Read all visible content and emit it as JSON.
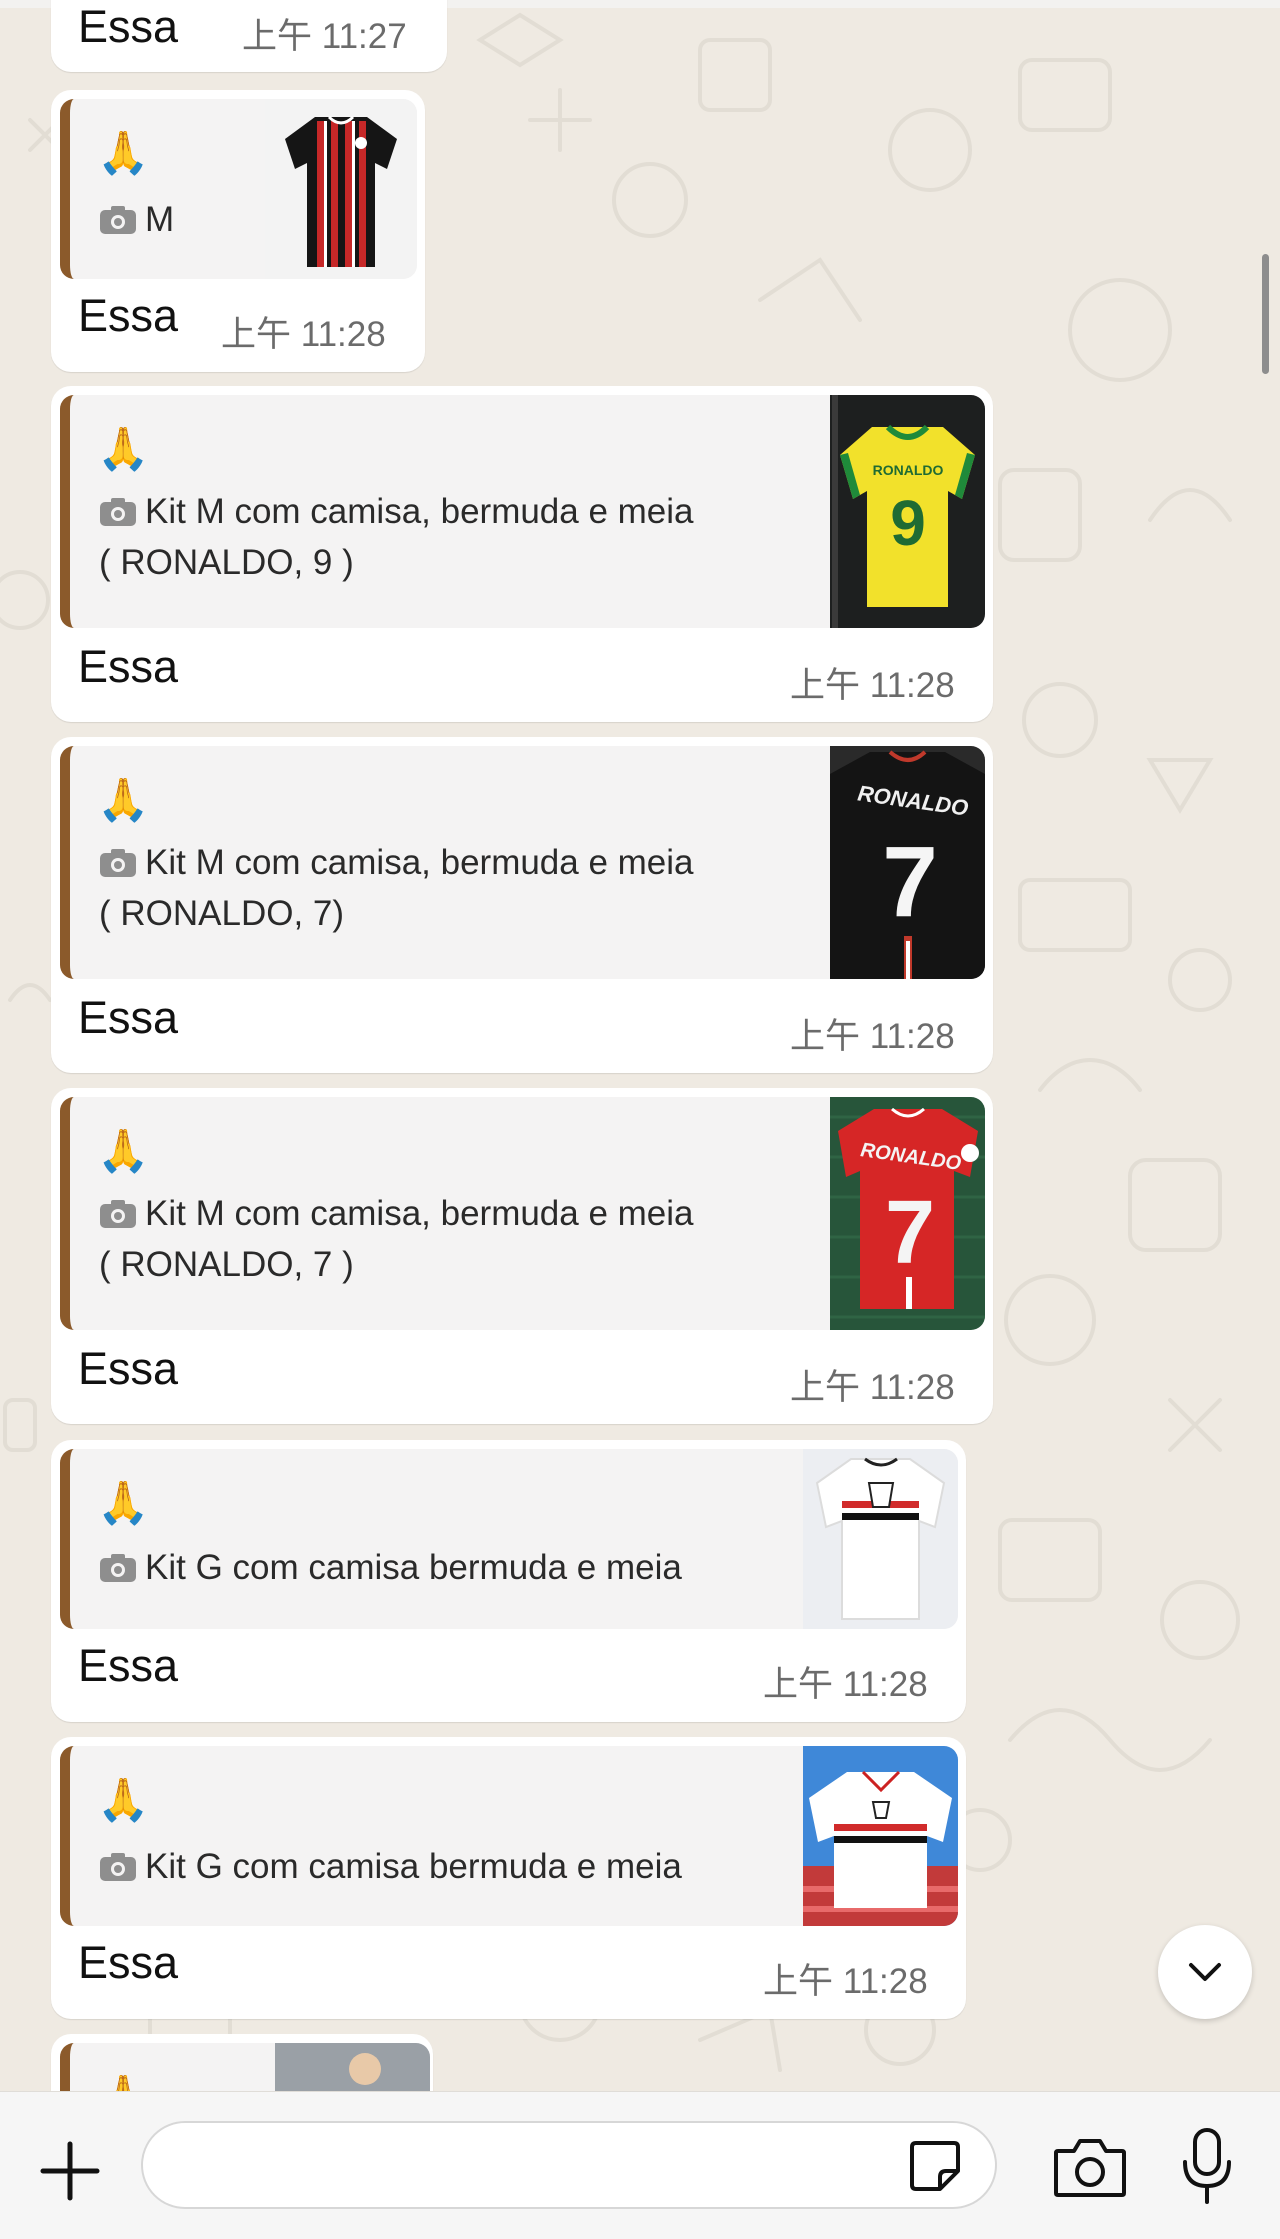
{
  "colors": {
    "wallpaper": "#efeae2",
    "bubble": "#ffffff",
    "quote_bg": "#f4f3f3",
    "quote_bar": "#8b5a2b",
    "timestamp": "#6b6b6b"
  },
  "messages": [
    {
      "quote": {
        "emoji": "🙏",
        "icon": "camera-icon",
        "lines": []
      },
      "text": "Essa",
      "time": "上午 11:27"
    },
    {
      "quote": {
        "emoji": "🙏",
        "icon": "camera-icon",
        "lines": [
          "M"
        ],
        "thumbnail": "jersey-red-black-stripes"
      },
      "text": "Essa",
      "time": "上午 11:28"
    },
    {
      "quote": {
        "emoji": "🙏",
        "icon": "camera-icon",
        "lines": [
          "Kit M com camisa, bermuda e meia",
          "( RONALDO, 9 )"
        ],
        "thumbnail": "jersey-yellow-ronaldo-9"
      },
      "text": "Essa",
      "time": "上午 11:28"
    },
    {
      "quote": {
        "emoji": "🙏",
        "icon": "camera-icon",
        "lines": [
          "Kit M com camisa, bermuda e meia",
          "( RONALDO, 7)"
        ],
        "thumbnail": "jersey-black-ronaldo-7"
      },
      "text": "Essa",
      "time": "上午 11:28"
    },
    {
      "quote": {
        "emoji": "🙏",
        "icon": "camera-icon",
        "lines": [
          "Kit M com camisa, bermuda e meia",
          "( RONALDO, 7 )"
        ],
        "thumbnail": "jersey-red-ronaldo-7"
      },
      "text": "Essa",
      "time": "上午 11:28"
    },
    {
      "quote": {
        "emoji": "🙏",
        "icon": "camera-icon",
        "lines": [
          "Kit G com camisa bermuda e meia"
        ],
        "thumbnail": "jersey-white-tricolor"
      },
      "text": "Essa",
      "time": "上午 11:28"
    },
    {
      "quote": {
        "emoji": "🙏",
        "icon": "camera-icon",
        "lines": [
          "Kit G com camisa bermuda e meia"
        ],
        "thumbnail": "jersey-white-retro"
      },
      "text": "Essa",
      "time": "上午 11:28"
    },
    {
      "quote": {
        "emoji": "🙏",
        "icon": "camera-icon",
        "lines": [],
        "thumbnail": "player-photo"
      },
      "text": "",
      "time": ""
    }
  ],
  "composer": {
    "input_value": "",
    "icons": [
      "plus-icon",
      "sticker-icon",
      "camera-icon",
      "microphone-icon"
    ]
  },
  "scroll_button_icon": "chevron-down-icon"
}
